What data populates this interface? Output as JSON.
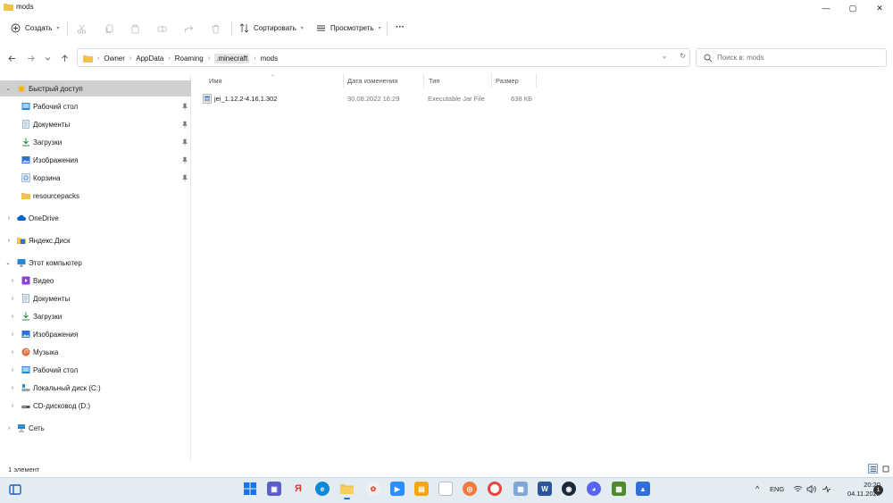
{
  "window": {
    "title": "mods",
    "min_glyph": "—",
    "max_glyph": "▢",
    "close_glyph": "✕"
  },
  "commandbar": {
    "new_label": "Создать",
    "sort_label": "Сортировать",
    "view_label": "Просмотреть",
    "more_glyph": "···"
  },
  "address": {
    "crumbs": [
      "Owner",
      "AppData",
      "Roaming",
      ".minecraft",
      "mods"
    ],
    "chevron": "›",
    "dropdown_glyph": "⌄",
    "refresh_glyph": "↻"
  },
  "search": {
    "placeholder": "Поиск в: mods"
  },
  "navpane": {
    "quick_access": "Быстрый доступ",
    "quick_items": [
      "Рабочий стол",
      "Документы",
      "Загрузки",
      "Изображения",
      "Корзина",
      "resourcepacks"
    ],
    "onedrive": "OneDrive",
    "yandex_disk": "Яндекс.Диск",
    "this_pc": "Этот компьютер",
    "pc_items": [
      "Видео",
      "Документы",
      "Загрузки",
      "Изображения",
      "Музыка",
      "Рабочий стол",
      "Локальный диск (C:)",
      "CD-дисковод (D:)"
    ],
    "network": "Сеть"
  },
  "filelist": {
    "columns": {
      "name": "Имя",
      "modified": "Дата изменения",
      "type": "Тип",
      "size": "Размер"
    },
    "rows": [
      {
        "name": "jei_1.12.2-4.16.1.302",
        "modified": "30.08.2022 16:29",
        "type": "Executable Jar File",
        "size": "638 КБ"
      }
    ]
  },
  "statusbar": {
    "count": "1 элемент"
  },
  "taskbar": {
    "tray_chevron": "^",
    "language": "ENG",
    "time": "20:20",
    "date": "04.11.2022",
    "notifications": "1"
  },
  "colors": {
    "folder": "#f2c14e",
    "accent": "#0067c0",
    "taskbar_bg": "#e3ecf2",
    "selection": "#cfcfcf"
  }
}
